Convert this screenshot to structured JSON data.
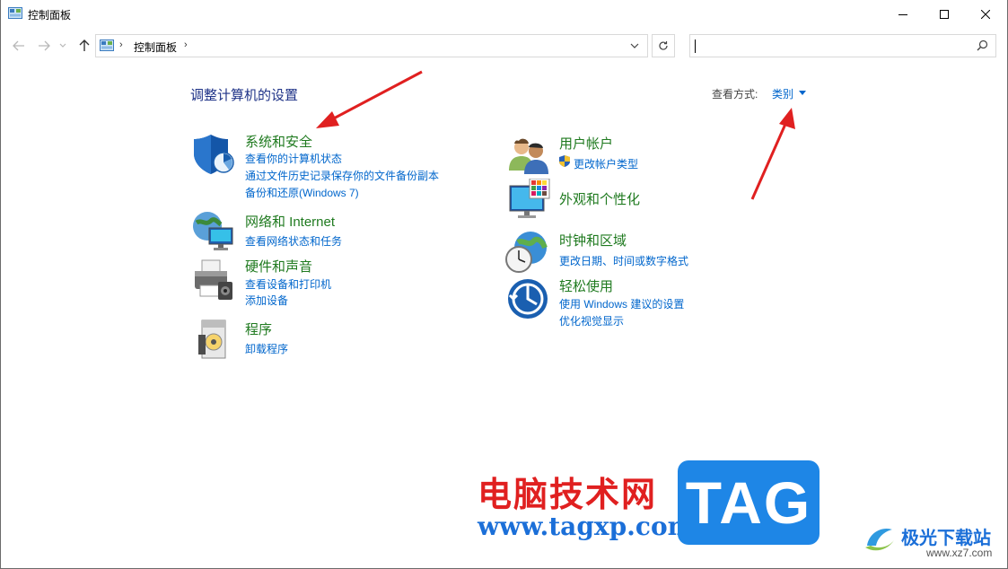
{
  "window": {
    "title": "控制面板",
    "minimize_icon": "minimize-icon",
    "maximize_icon": "maximize-icon",
    "close_icon": "close-icon"
  },
  "navigation": {
    "back_icon": "arrow-left-icon",
    "forward_icon": "arrow-right-icon",
    "recent_icon": "chevron-down-icon",
    "up_icon": "arrow-up-icon",
    "breadcrumb": [
      "控制面板"
    ],
    "refresh_icon": "refresh-icon",
    "search_value": "",
    "search_icon": "search-icon"
  },
  "main": {
    "heading": "调整计算机的设置",
    "view_by_label": "查看方式:",
    "view_by_value": "类别"
  },
  "categories": [
    {
      "title": "系统和安全",
      "icon": "shield-icon",
      "links": [
        "查看你的计算机状态",
        "通过文件历史记录保存你的文件备份副本",
        "备份和还原(Windows 7)"
      ]
    },
    {
      "title": "网络和 Internet",
      "icon": "globe-network-icon",
      "links": [
        "查看网络状态和任务"
      ]
    },
    {
      "title": "硬件和声音",
      "icon": "printer-icon",
      "links": [
        "查看设备和打印机",
        "添加设备"
      ]
    },
    {
      "title": "程序",
      "icon": "programs-disc-icon",
      "links": [
        "卸载程序"
      ]
    },
    {
      "title": "用户帐户",
      "icon": "users-icon",
      "links": [
        "更改帐户类型"
      ]
    },
    {
      "title": "外观和个性化",
      "icon": "monitor-palette-icon",
      "links": []
    },
    {
      "title": "时钟和区域",
      "icon": "clock-globe-icon",
      "links": [
        "更改日期、时间或数字格式"
      ]
    },
    {
      "title": "轻松使用",
      "icon": "ease-of-access-icon",
      "links": [
        "使用 Windows 建议的设置",
        "优化视觉显示"
      ]
    }
  ],
  "watermark": {
    "chinese": "电脑技术网",
    "url": "www.tagxp.com",
    "tag": "TAG",
    "site_name": "极光下载站",
    "site_url": "www.xz7.com"
  },
  "colors": {
    "category_title": "#1f7a1f",
    "link": "#0066cc",
    "heading": "#1e3287",
    "annotation_arrow": "#e02020"
  }
}
